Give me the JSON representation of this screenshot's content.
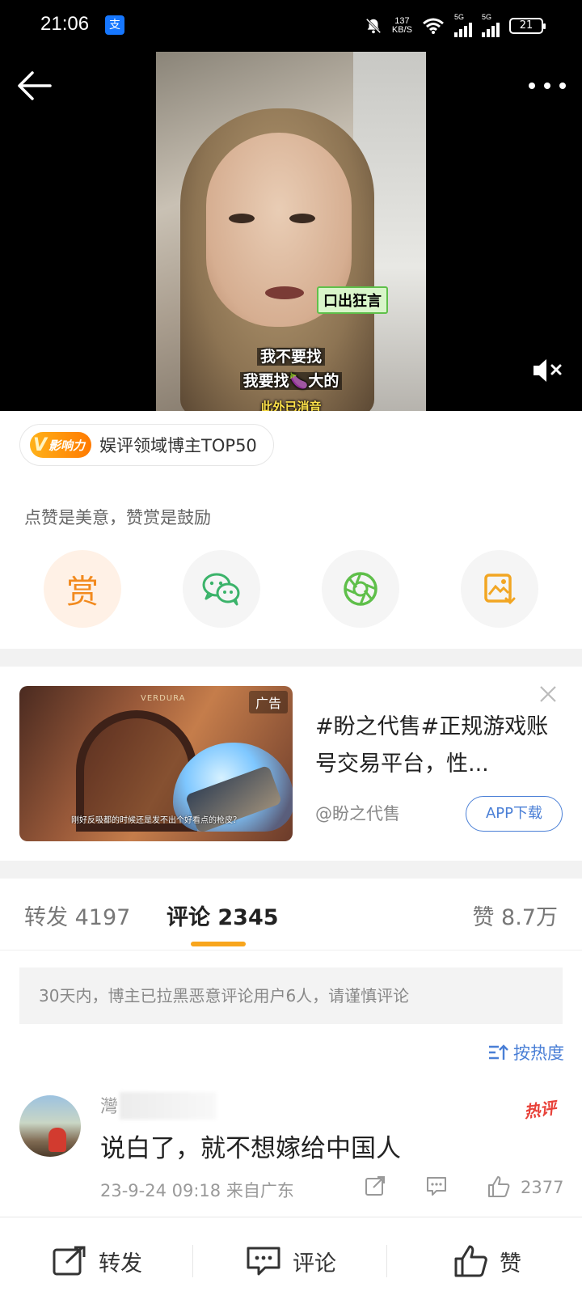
{
  "status_bar": {
    "time": "21:06",
    "net_speed_value": "137",
    "net_speed_unit": "KB/S",
    "sim1_label": "5G",
    "sim2_label": "5G",
    "battery": "21",
    "app_icon": "alipay-icon"
  },
  "video": {
    "sticker_text": "口出狂言",
    "subtitle_line1": "我不要找",
    "subtitle_line2": "我要找🍆大的",
    "subtitle_line3": "此外已消音"
  },
  "influence": {
    "badge_letter": "V",
    "badge_label": "影响力",
    "text": "娱评领域博主TOP50"
  },
  "reward_tip": "点赞是美意，赞赏是鼓励",
  "share": {
    "reward_label": "赏",
    "icons": [
      "reward-icon",
      "wechat-icon",
      "moments-icon",
      "save-image-icon"
    ],
    "colors": {
      "reward": "#f28a1e",
      "wechat": "#3bb36a",
      "moments": "#5fbf4a",
      "save": "#f2a623"
    }
  },
  "ad": {
    "tag": "广告",
    "image_caption": "刚好反吸都的时候还是发不出个好看点的枪皮？",
    "image_sign": "VERDURA",
    "title": "#盼之代售#正规游戏账号交易平台，性...",
    "source": "@盼之代售",
    "download_label": "APP下载"
  },
  "tabs": {
    "repost": "转发 4197",
    "comment": "评论 2345",
    "like": "赞 8.7万"
  },
  "notice": "30天内，博主已拉黑恶意评论用户6人，请谨慎评论",
  "sort_label": "按热度",
  "comment": {
    "username_visible": "灣",
    "hot_label": "热评",
    "text": "说白了，就不想嫁给中国人",
    "meta": "23-9-24 09:18  来自广东",
    "likes": "2377"
  },
  "bottom_bar": {
    "repost": "转发",
    "comment": "评论",
    "like": "赞"
  },
  "colors": {
    "accent_orange": "#f8a51c",
    "link_blue": "#4a7fd6",
    "hot_red": "#e8423a"
  }
}
